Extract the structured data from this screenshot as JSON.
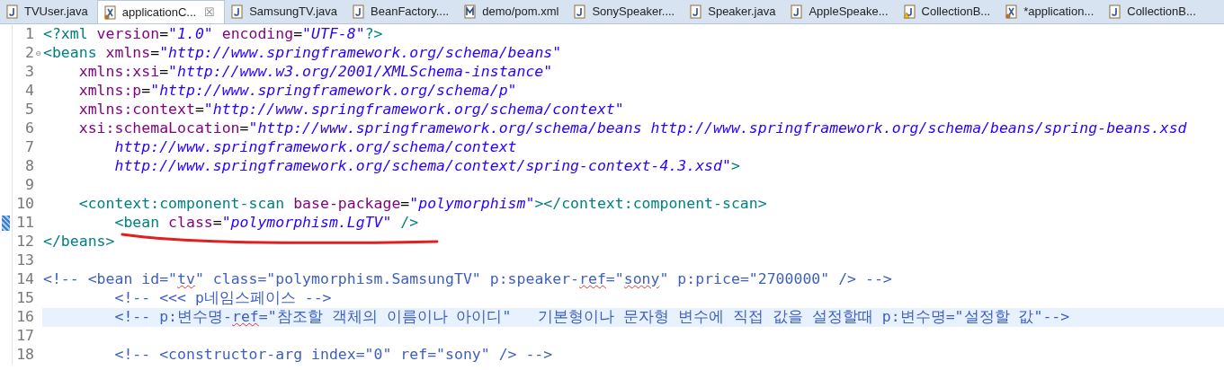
{
  "tabs": [
    {
      "label": "TVUser.java",
      "kind": "java",
      "selected": false
    },
    {
      "label": "applicationC...",
      "kind": "xml",
      "selected": true,
      "close": "☒"
    },
    {
      "label": "SamsungTV.java",
      "kind": "java",
      "selected": false
    },
    {
      "label": "BeanFactory....",
      "kind": "java",
      "selected": false
    },
    {
      "label": "demo/pom.xml",
      "kind": "maven",
      "selected": false
    },
    {
      "label": "SonySpeaker....",
      "kind": "java",
      "selected": false
    },
    {
      "label": "Speaker.java",
      "kind": "java",
      "selected": false
    },
    {
      "label": "AppleSpeake...",
      "kind": "java",
      "selected": false
    },
    {
      "label": "CollectionB...",
      "kind": "java",
      "selected": false,
      "warning": true
    },
    {
      "label": "*application...",
      "kind": "xml",
      "selected": false
    },
    {
      "label": "CollectionB...",
      "kind": "java",
      "selected": false
    }
  ],
  "editor": {
    "lines": [
      {
        "number": "1",
        "tokens": [
          {
            "kind": "tag",
            "text": "<?xml"
          },
          {
            "kind": "attr",
            "text": " version"
          },
          {
            "kind": "plain",
            "text": "="
          },
          {
            "kind": "value",
            "text": "\"1.0\""
          },
          {
            "kind": "attr",
            "text": " encoding"
          },
          {
            "kind": "plain",
            "text": "="
          },
          {
            "kind": "value",
            "text": "\"UTF-8\""
          },
          {
            "kind": "tag",
            "text": "?>"
          }
        ]
      },
      {
        "number": "2",
        "fold": "⊖",
        "tokens": [
          {
            "kind": "tag",
            "text": "<beans"
          },
          {
            "kind": "attr",
            "text": " xmlns"
          },
          {
            "kind": "plain",
            "text": "="
          },
          {
            "kind": "value",
            "text": "\"http://www.springframework.org/schema/beans\""
          }
        ]
      },
      {
        "number": "3",
        "tokens": [
          {
            "kind": "attr",
            "text": "    xmlns:xsi"
          },
          {
            "kind": "plain",
            "text": "="
          },
          {
            "kind": "value",
            "text": "\"http://www.w3.org/2001/XMLSchema-instance\""
          }
        ]
      },
      {
        "number": "4",
        "tokens": [
          {
            "kind": "attr",
            "text": "    xmlns:p"
          },
          {
            "kind": "plain",
            "text": "="
          },
          {
            "kind": "value",
            "text": "\"http://www.springframework.org/schema/p\""
          }
        ]
      },
      {
        "number": "5",
        "tokens": [
          {
            "kind": "attr",
            "text": "    xmlns:context"
          },
          {
            "kind": "plain",
            "text": "="
          },
          {
            "kind": "value",
            "text": "\"http://www.springframework.org/schema/context\""
          }
        ]
      },
      {
        "number": "6",
        "tokens": [
          {
            "kind": "attr",
            "text": "    xsi:schemaLocation"
          },
          {
            "kind": "plain",
            "text": "="
          },
          {
            "kind": "value",
            "text": "\"http://www.springframework.org/schema/beans http://www.springframework.org/schema/beans/spring-beans.xsd"
          }
        ]
      },
      {
        "number": "7",
        "tokens": [
          {
            "kind": "value",
            "text": "        http://www.springframework.org/schema/context"
          }
        ]
      },
      {
        "number": "8",
        "tokens": [
          {
            "kind": "value",
            "text": "        http://www.springframework.org/schema/context/spring-context-4.3.xsd\""
          },
          {
            "kind": "tag",
            "text": ">"
          }
        ]
      },
      {
        "number": "9"
      },
      {
        "number": "10",
        "tokens": [
          {
            "kind": "tag",
            "text": "    <context:component-scan"
          },
          {
            "kind": "attr",
            "text": " base-package"
          },
          {
            "kind": "plain",
            "text": "="
          },
          {
            "kind": "value",
            "text": "\"polymorphism\""
          },
          {
            "kind": "tag",
            "text": "></context:component-scan>"
          }
        ]
      },
      {
        "number": "11",
        "marker": true,
        "tokens": [
          {
            "kind": "tag",
            "text": "        <bean"
          },
          {
            "kind": "attr",
            "text": " class"
          },
          {
            "kind": "plain",
            "text": "="
          },
          {
            "kind": "value",
            "text": "\"polymorphism.LgTV\""
          },
          {
            "kind": "tag",
            "text": " />"
          }
        ]
      },
      {
        "number": "12",
        "tokens": [
          {
            "kind": "tag",
            "text": "</beans>"
          }
        ]
      },
      {
        "number": "13"
      },
      {
        "number": "14",
        "tokens": [
          {
            "kind": "comment",
            "text": "<!-- <bean id=\""
          },
          {
            "kind": "misspelled",
            "text": "tv"
          },
          {
            "kind": "comment",
            "text": "\" class=\"polymorphism.SamsungTV\" p:speaker-"
          },
          {
            "kind": "misspelled",
            "text": "ref"
          },
          {
            "kind": "comment",
            "text": "=\""
          },
          {
            "kind": "misspelled",
            "text": "sony"
          },
          {
            "kind": "comment",
            "text": "\" p:price=\"2700000\" /> -->"
          }
        ]
      },
      {
        "number": "15",
        "tokens": [
          {
            "kind": "comment",
            "text": "        <!-- <<< p네임스페이스 -->"
          }
        ]
      },
      {
        "number": "16",
        "current": true,
        "tokens": [
          {
            "kind": "comment",
            "text": "        <!-- p:변수명-"
          },
          {
            "kind": "misspelled",
            "text": "ref"
          },
          {
            "kind": "comment",
            "text": "=\"참조할 객체의 이름이나 아이디\"   기본형이나 문자형 변수에 직접 값을 설정할때 p:변수명=\"설정할 값\"-->"
          }
        ]
      },
      {
        "number": "17"
      },
      {
        "number": "18",
        "tokens": [
          {
            "kind": "comment",
            "text": "        <!-- <constructor-arg index=\"0\" ref=\"sony\" /> -->"
          }
        ]
      }
    ]
  }
}
